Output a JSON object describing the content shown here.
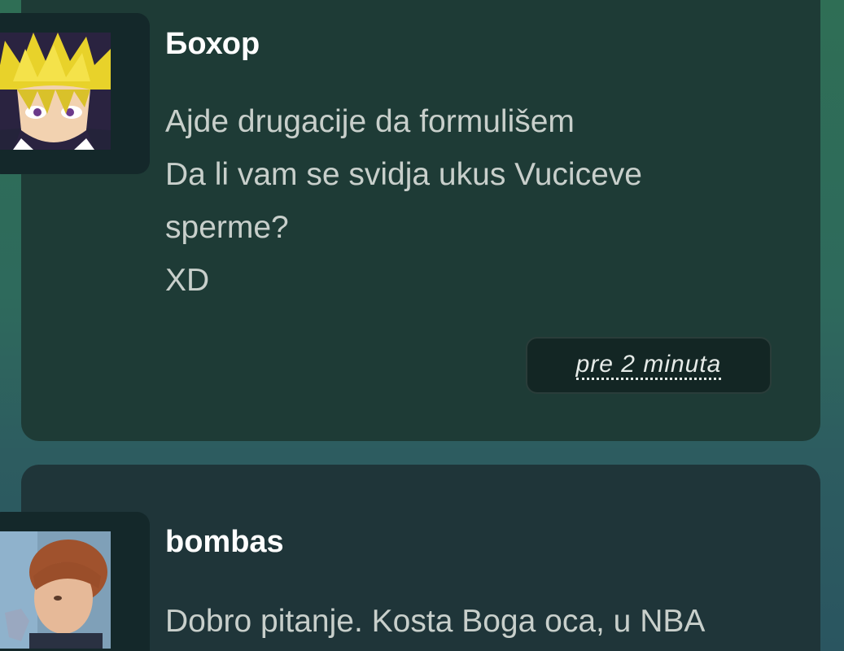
{
  "posts": [
    {
      "username": "Бохор",
      "avatar_desc": "anime-spiky-hair-avatar",
      "message_lines": [
        "Ajde drugacije da formulišem",
        "Da li vam se svidja ukus Vuciceve",
        "sperme?",
        "XD"
      ],
      "timestamp": "pre 2 minuta"
    },
    {
      "username": "bombas",
      "avatar_desc": "boy-photo-avatar",
      "message_lines": [
        "Dobro pitanje. Kosta Boga oca, u NBA"
      ]
    }
  ],
  "colors": {
    "card_primary": "#1e3b36",
    "card_secondary": "#1f3539",
    "username_text": "#ffffff",
    "message_text": "#c8cfcb"
  }
}
